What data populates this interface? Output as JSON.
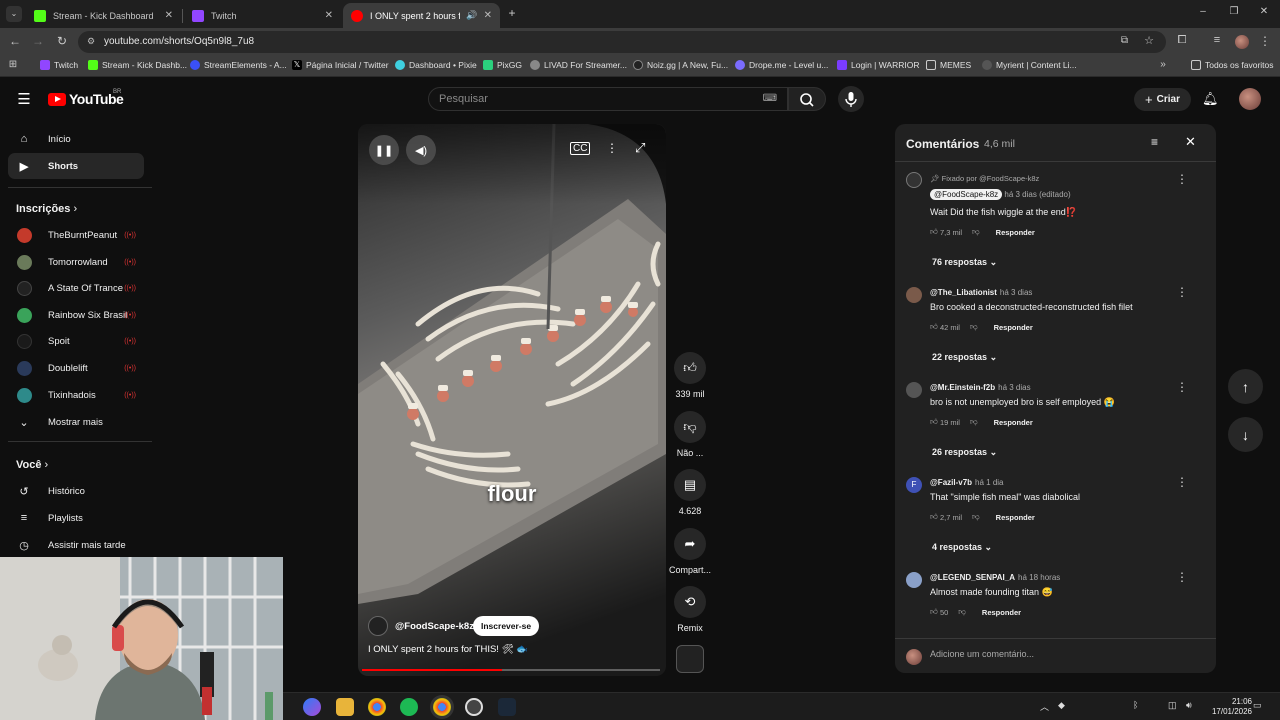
{
  "browser": {
    "tabs": [
      {
        "title": "Stream - Kick Dashboard",
        "color": "#53fc18"
      },
      {
        "title": "Twitch",
        "color": "#9146ff"
      },
      {
        "title": "I ONLY spent 2 hours for Th",
        "color": "#ff0000"
      }
    ],
    "url": "youtube.com/shorts/Oq5n9l8_7u8",
    "bookmarks": [
      {
        "label": "Twitch",
        "color": "#9146ff"
      },
      {
        "label": "Stream - Kick Dashb...",
        "color": "#53fc18"
      },
      {
        "label": "StreamElements - A...",
        "color": "#3a50f6"
      },
      {
        "label": "Página Inicial / Twitter",
        "color": "#000000"
      },
      {
        "label": "Dashboard • Pixie",
        "color": "#3fd0e0"
      },
      {
        "label": "PixGG",
        "color": "#2bd17e"
      },
      {
        "label": "LIVAD For Streamer...",
        "color": "#888888"
      },
      {
        "label": "Noiz.gg | A New, Fu...",
        "color": "#222222"
      },
      {
        "label": "Drope.me - Level u...",
        "color": "#7b6cff"
      },
      {
        "label": "Login | WARRIOR",
        "color": "#7a3cff"
      },
      {
        "label": "MEMES",
        "color": "#999999"
      },
      {
        "label": "Myrient | Content Li...",
        "color": "#555555"
      }
    ],
    "all_bookmarks": "Todos os favoritos"
  },
  "youtube": {
    "logo_text": "YouTube",
    "logo_country": "BR",
    "search_placeholder": "Pesquisar",
    "create_label": "Criar",
    "sidebar": {
      "main": [
        {
          "label": "Início",
          "icon": "home-icon"
        },
        {
          "label": "Shorts",
          "icon": "shorts-icon"
        }
      ],
      "subscriptions_heading": "Inscrições",
      "subscriptions": [
        {
          "label": "TheBurntPeanut",
          "color": "#c43a2b"
        },
        {
          "label": "Tomorrowland",
          "color": "#6a7a5a"
        },
        {
          "label": "A State Of Trance",
          "color": "#222222"
        },
        {
          "label": "Rainbow Six Brasil",
          "color": "#3aa35a"
        },
        {
          "label": "Spoit",
          "color": "#1a1a1a"
        },
        {
          "label": "Doublelift",
          "color": "#2a3a5a"
        },
        {
          "label": "Tixinhadois",
          "color": "#2e8a8a"
        }
      ],
      "show_more": "Mostrar mais",
      "you_heading": "Você",
      "you_items": [
        {
          "label": "Histórico",
          "icon": "history-icon"
        },
        {
          "label": "Playlists",
          "icon": "playlists-icon"
        },
        {
          "label": "Assistir mais tarde",
          "icon": "watch-later-icon"
        }
      ]
    },
    "short": {
      "caption": "flour",
      "channel": "@FoodScape-k8z",
      "subscribe_label": "Inscrever-se",
      "title": "I ONLY spent 2 hours for THIS! 🛠 🐟",
      "progress": 0.47,
      "actions": [
        {
          "label": "339 mil",
          "icon": "like-icon"
        },
        {
          "label": "Não ...",
          "icon": "dislike-icon"
        },
        {
          "label": "4.628",
          "icon": "comment-icon"
        },
        {
          "label": "Compart...",
          "icon": "share-icon"
        },
        {
          "label": "Remix",
          "icon": "remix-icon"
        }
      ]
    },
    "comments": {
      "title": "Comentários",
      "count": "4,6 mil",
      "pinned_by": "Fixado por @FoodScape-k8z",
      "items": [
        {
          "user": "@FoodScape-k8z",
          "time": "há 3 dias (editado)",
          "text": "Wait Did the fish wiggle at the end⁉️",
          "likes": "7,3 mil",
          "replies": "76 respostas",
          "color": "#333333"
        },
        {
          "user": "@The_Libationist",
          "time": "há 3 dias",
          "text": "Bro cooked a deconstructed-reconstructed fish filet",
          "likes": "42 mil",
          "replies": "22 respostas",
          "color": "#7a5a4a"
        },
        {
          "user": "@Mr.Einstein-f2b",
          "time": "há 3 dias",
          "text": "bro is not unemployed bro is self employed 😭",
          "likes": "19 mil",
          "replies": "26 respostas",
          "color": "#555555"
        },
        {
          "user": "@Fazil-v7b",
          "time": "há 1 dia",
          "text": "That \"simple fish meal\" was diabolical",
          "likes": "2,7 mil",
          "replies": "4 respostas",
          "color": "#3f51b5"
        },
        {
          "user": "@LEGEND_SENPAI_A",
          "time": "há 18 horas",
          "text": "Almost made founding titan 😅",
          "likes": "50",
          "replies": "",
          "color": "#8aa0c8"
        }
      ],
      "reply_label": "Responder",
      "add_placeholder": "Adicione um comentário..."
    }
  },
  "taskbar": {
    "time": "21:06",
    "date": "17/01/2026"
  }
}
